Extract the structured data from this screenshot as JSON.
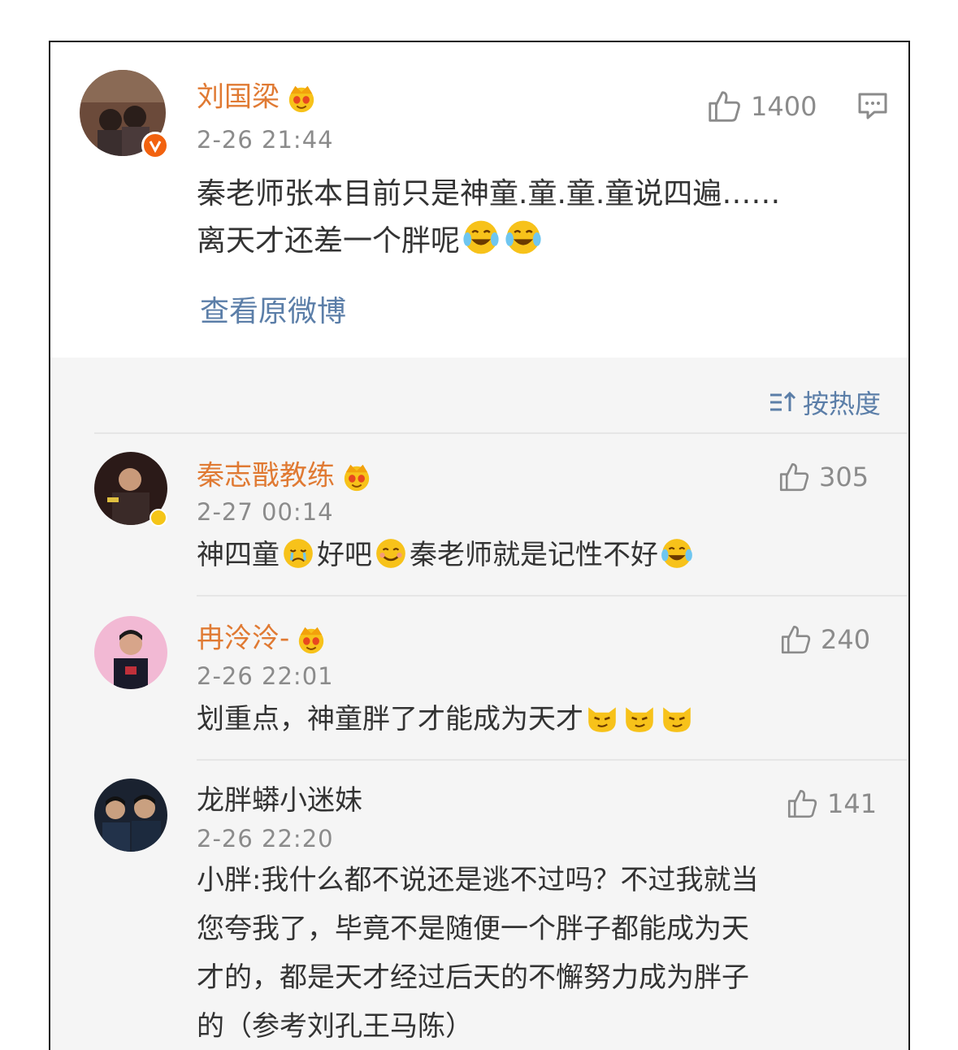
{
  "main_post": {
    "username": "刘国梁",
    "time": "2-26 21:44",
    "likes": "1400",
    "text_line1": "秦老师张本目前只是神童.童.童.童说四遍……",
    "text_line2": "离天才还差一个胖呢",
    "view_original": "查看原微博"
  },
  "sort_label": "按热度",
  "comments": [
    {
      "username": "秦志戬教练",
      "time": "2-27 00:14",
      "likes": "305",
      "seg1": "神四童",
      "seg2": "好吧",
      "seg3": "秦老师就是记性不好"
    },
    {
      "username": "冉泠泠-",
      "time": "2-26 22:01",
      "likes": "240",
      "text": "划重点，神童胖了才能成为天才"
    },
    {
      "username": "龙胖蟒小迷妹",
      "time": "2-26 22:20",
      "likes": "141",
      "line1": "小胖:我什么都不说还是逃不过吗？不过我就当",
      "line2": "您夸我了，毕竟不是随便一个胖子都能成为天",
      "line3": "才的，都是天才经过后天的不懈努力成为胖子",
      "line4": "的（参考刘孔王马陈）"
    }
  ],
  "colors": {
    "username": "#e07a33",
    "link": "#5b7ea8",
    "meta": "#8b8b8b",
    "text": "#333333"
  },
  "icons": [
    "crown-icon",
    "thumbs-up-icon",
    "comment-icon",
    "sort-icon",
    "laugh-cry-emoji",
    "cry-emoji",
    "smile-emoji",
    "smirk-emoji"
  ]
}
